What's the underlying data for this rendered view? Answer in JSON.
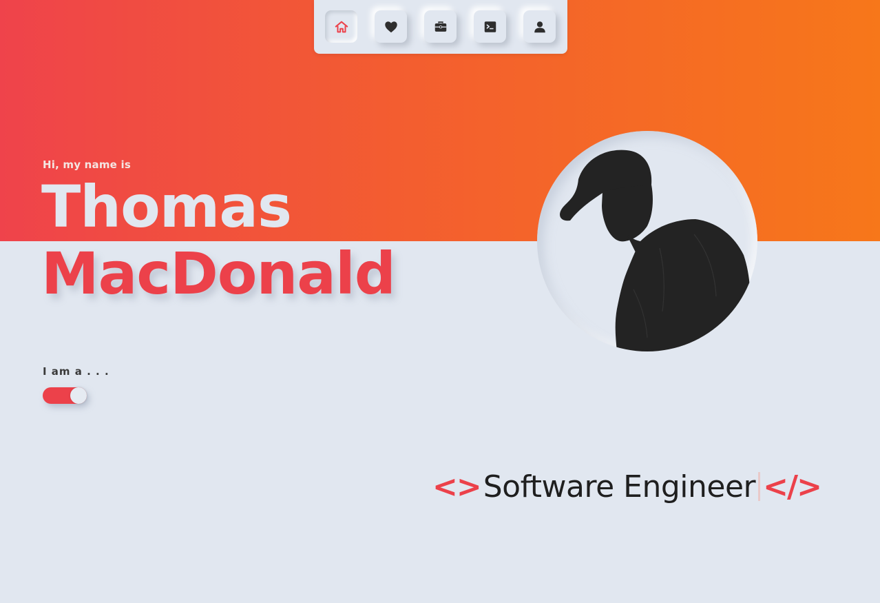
{
  "nav": {
    "items": [
      {
        "label": "Home",
        "icon": "home-icon",
        "active": true
      },
      {
        "label": "Favorites",
        "icon": "heart-icon",
        "active": false
      },
      {
        "label": "Work",
        "icon": "briefcase-icon",
        "active": false
      },
      {
        "label": "Terminal",
        "icon": "terminal-icon",
        "active": false
      },
      {
        "label": "Profile",
        "icon": "user-icon",
        "active": false
      }
    ]
  },
  "hero": {
    "intro": "Hi, my name is",
    "first_name": "Thomas",
    "last_name": "MacDonald"
  },
  "role": {
    "label": "I am a . . .",
    "toggle_on": true,
    "open_tag": "<>",
    "title": "Software Engineer",
    "close_tag": "</>"
  },
  "colors": {
    "accent": "#ec414a",
    "gradient_start": "#ef434b",
    "gradient_end": "#f7771a",
    "background": "#e1e7f0",
    "text_dark": "#1f1f1f"
  }
}
